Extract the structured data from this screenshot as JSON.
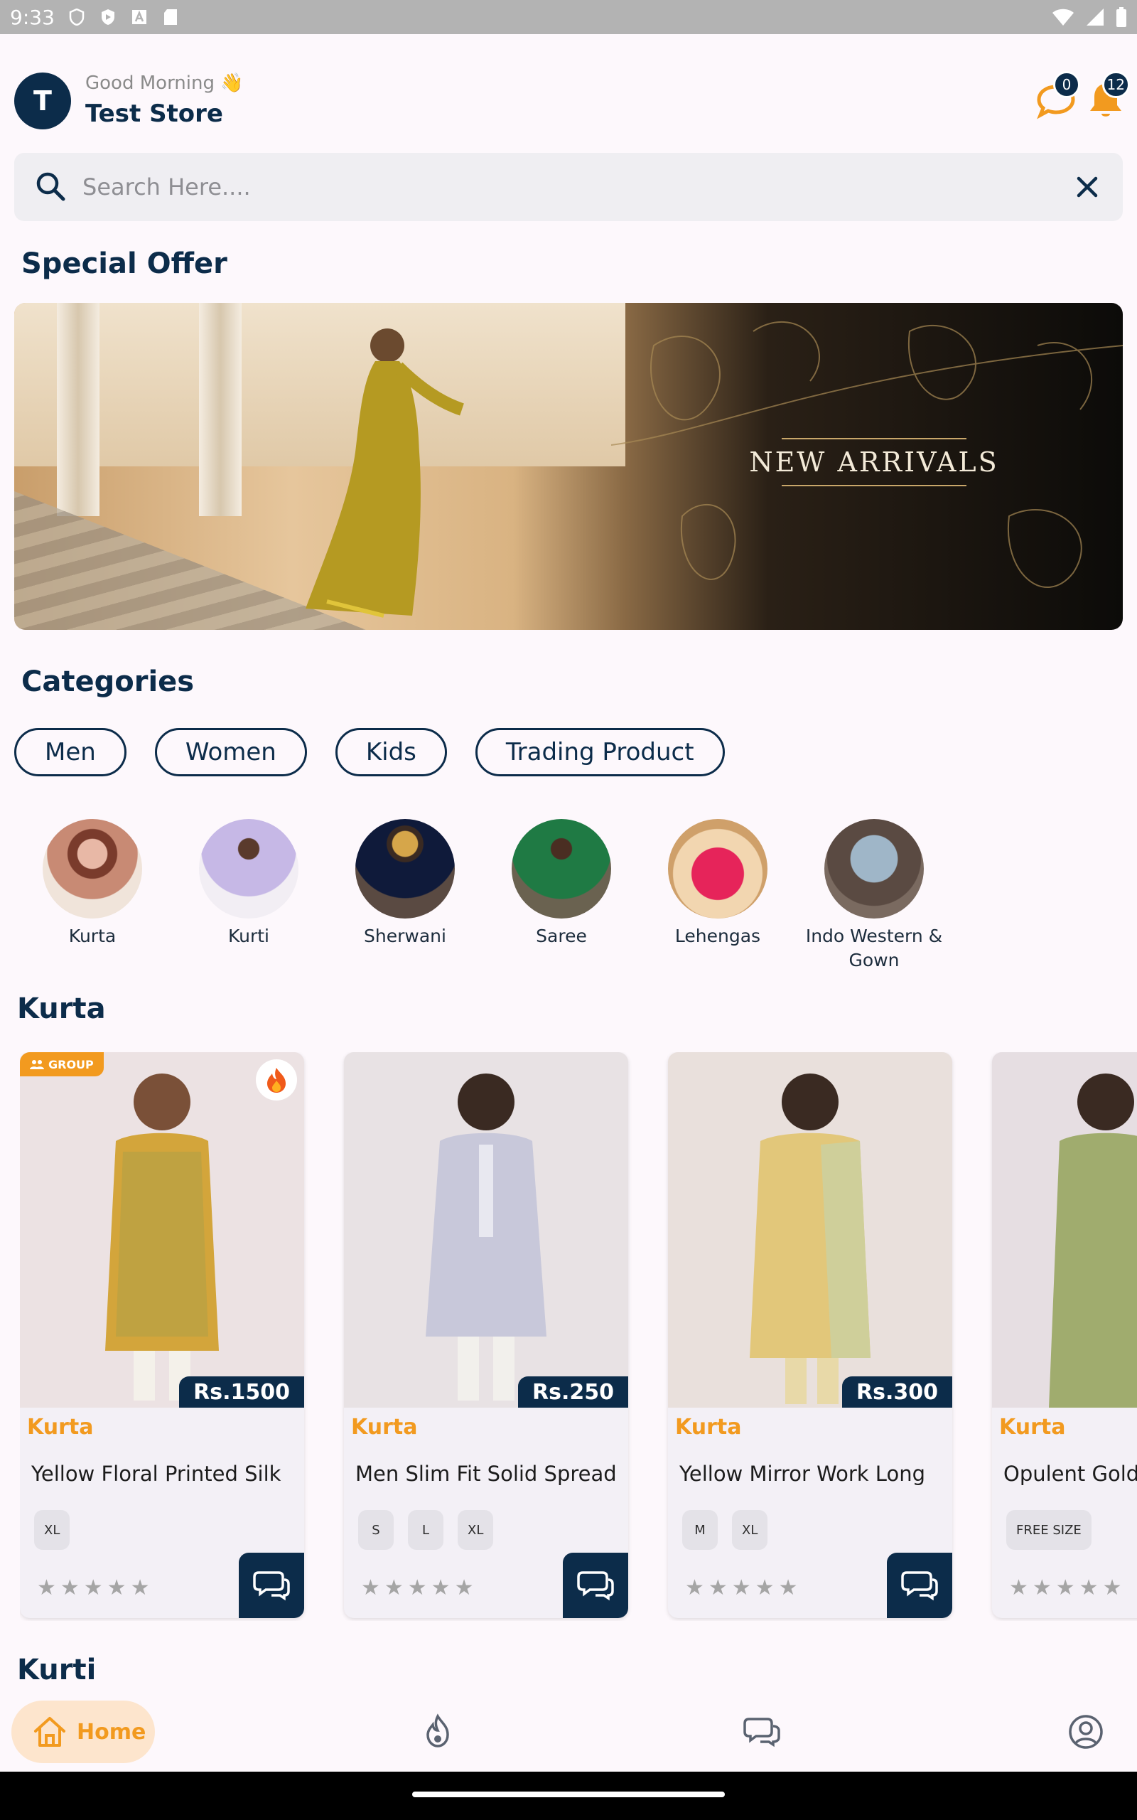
{
  "status_bar": {
    "time": "9:33"
  },
  "header": {
    "avatar_letter": "T",
    "greeting": "Good Morning 👋",
    "store_name": "Test Store",
    "chat_badge": "0",
    "notification_badge": "12"
  },
  "search": {
    "placeholder": "Search Here...."
  },
  "special_offer": {
    "title": "Special Offer",
    "banner_text": "NEW ARRIVALS"
  },
  "categories": {
    "title": "Categories",
    "chips": [
      "Men",
      "Women",
      "Kids",
      "Trading Product"
    ],
    "items": [
      "Kurta",
      "Kurti",
      "Sherwani",
      "Saree",
      "Lehengas",
      "Indo Western & Gown"
    ]
  },
  "kurta_section": {
    "title": "Kurta",
    "products": [
      {
        "category": "Kurta",
        "name": "Yellow Floral Printed Silk",
        "price": "Rs.1500",
        "sizes": [
          "XL"
        ],
        "badge": "GROUP"
      },
      {
        "category": "Kurta",
        "name": "Men Slim Fit Solid Spread",
        "price": "Rs.250",
        "sizes": [
          "S",
          "L",
          "XL"
        ]
      },
      {
        "category": "Kurta",
        "name": "Yellow Mirror Work Long",
        "price": "Rs.300",
        "sizes": [
          "M",
          "XL"
        ]
      },
      {
        "category": "Kurta",
        "name": "Opulent Gold",
        "price": "",
        "sizes": [
          "FREE SIZE"
        ]
      }
    ]
  },
  "kurti_section": {
    "title": "Kurti"
  },
  "bottom_nav": {
    "home_label": "Home"
  }
}
